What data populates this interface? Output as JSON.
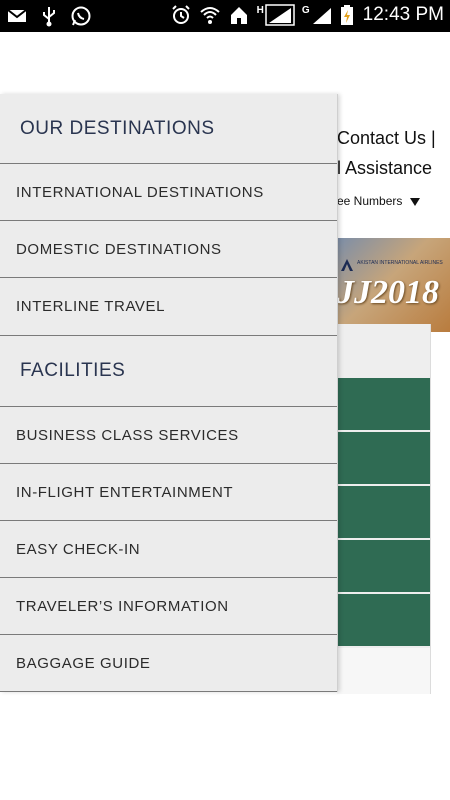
{
  "status_bar": {
    "time": "12:43 PM",
    "left_icons": [
      "mail-icon",
      "usb-icon",
      "whatsapp-icon"
    ],
    "right_icons": [
      "alarm-icon",
      "wifi-icon",
      "home-icon",
      "signal-h-icon",
      "signal-g-icon",
      "battery-charging-icon"
    ],
    "network_h": "H",
    "network_g": "G"
  },
  "background_page": {
    "contact": "Contact Us |",
    "assistance": "l Assistance",
    "toll_free": "ee Numbers",
    "banner_small": "AKISTAN INTERNATIONAL AIRLINES",
    "banner_year": "JJ2018",
    "colors": {
      "green_button": "#2f6b53"
    }
  },
  "drawer": {
    "sections": [
      {
        "heading": "OUR DESTINATIONS",
        "items": [
          "INTERNATIONAL DESTINATIONS",
          "DOMESTIC DESTINATIONS",
          "INTERLINE TRAVEL"
        ]
      },
      {
        "heading": "FACILITIES",
        "items": [
          "BUSINESS CLASS SERVICES",
          "IN-FLIGHT ENTERTAINMENT",
          "EASY CHECK-IN",
          "TRAVELER’S INFORMATION",
          "BAGGAGE GUIDE"
        ]
      }
    ]
  }
}
